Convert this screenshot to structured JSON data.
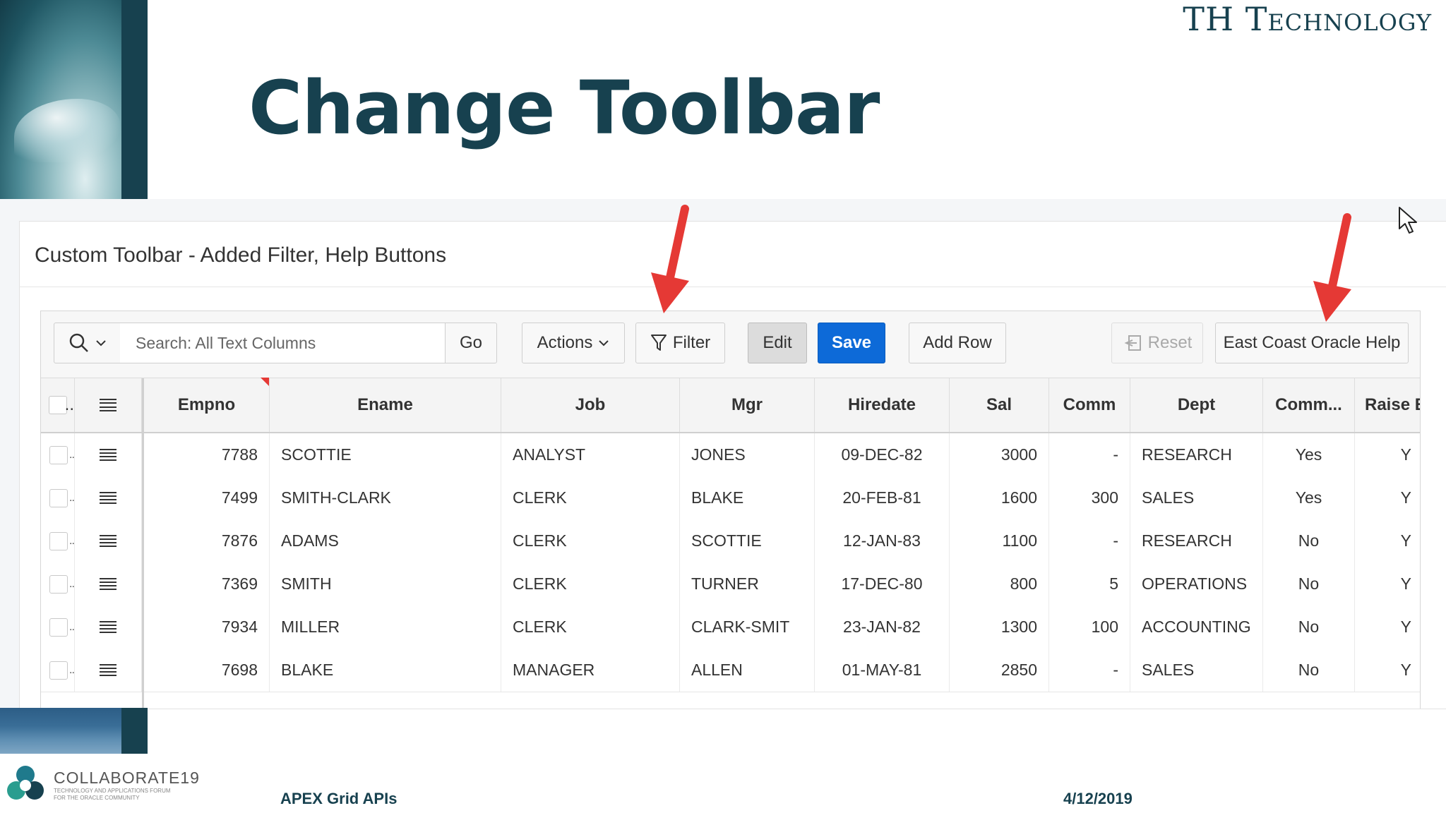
{
  "slide": {
    "brand": "TH Technology",
    "title": "Change Toolbar",
    "footer_title": "APEX Grid APIs",
    "footer_date": "4/12/2019",
    "logo_name": "COLLABORATE19",
    "logo_sub": "TECHNOLOGY AND APPLICATIONS FORUM FOR THE ORACLE COMMUNITY"
  },
  "region": {
    "title": "Custom Toolbar - Added Filter, Help Buttons"
  },
  "toolbar": {
    "search_placeholder": "Search: All Text Columns",
    "go_label": "Go",
    "actions_label": "Actions",
    "filter_label": "Filter",
    "edit_label": "Edit",
    "save_label": "Save",
    "add_row_label": "Add Row",
    "reset_label": "Reset",
    "help_label": "East Coast Oracle Help"
  },
  "grid": {
    "headers": {
      "selector": "..",
      "empno": "Empno",
      "ename": "Ename",
      "job": "Job",
      "mgr": "Mgr",
      "hiredate": "Hiredate",
      "sal": "Sal",
      "comm": "Comm",
      "dept": "Dept",
      "comm2": "Comm...",
      "raise": "Raise E"
    },
    "row_dots": "..",
    "rows": [
      {
        "empno": "7788",
        "ename": "SCOTTIE",
        "job": "ANALYST",
        "mgr": "JONES",
        "hiredate": "09-DEC-82",
        "sal": "3000",
        "comm": "-",
        "dept": "RESEARCH",
        "comm2": "Yes",
        "raise": "Y"
      },
      {
        "empno": "7499",
        "ename": "SMITH-CLARK",
        "job": "CLERK",
        "mgr": "BLAKE",
        "hiredate": "20-FEB-81",
        "sal": "1600",
        "comm": "300",
        "dept": "SALES",
        "comm2": "Yes",
        "raise": "Y"
      },
      {
        "empno": "7876",
        "ename": "ADAMS",
        "job": "CLERK",
        "mgr": "SCOTTIE",
        "hiredate": "12-JAN-83",
        "sal": "1100",
        "comm": "-",
        "dept": "RESEARCH",
        "comm2": "No",
        "raise": "Y"
      },
      {
        "empno": "7369",
        "ename": "SMITH",
        "job": "CLERK",
        "mgr": "TURNER",
        "hiredate": "17-DEC-80",
        "sal": "800",
        "comm": "5",
        "dept": "OPERATIONS",
        "comm2": "No",
        "raise": "Y"
      },
      {
        "empno": "7934",
        "ename": "MILLER",
        "job": "CLERK",
        "mgr": "CLARK-SMIT",
        "hiredate": "23-JAN-82",
        "sal": "1300",
        "comm": "100",
        "dept": "ACCOUNTING",
        "comm2": "No",
        "raise": "Y"
      },
      {
        "empno": "7698",
        "ename": "BLAKE",
        "job": "MANAGER",
        "mgr": "ALLEN",
        "hiredate": "01-MAY-81",
        "sal": "2850",
        "comm": "-",
        "dept": "SALES",
        "comm2": "No",
        "raise": "Y"
      }
    ]
  },
  "colors": {
    "brand": "#17414f",
    "primary": "#0d6ad8",
    "arrow": "#e53935"
  }
}
